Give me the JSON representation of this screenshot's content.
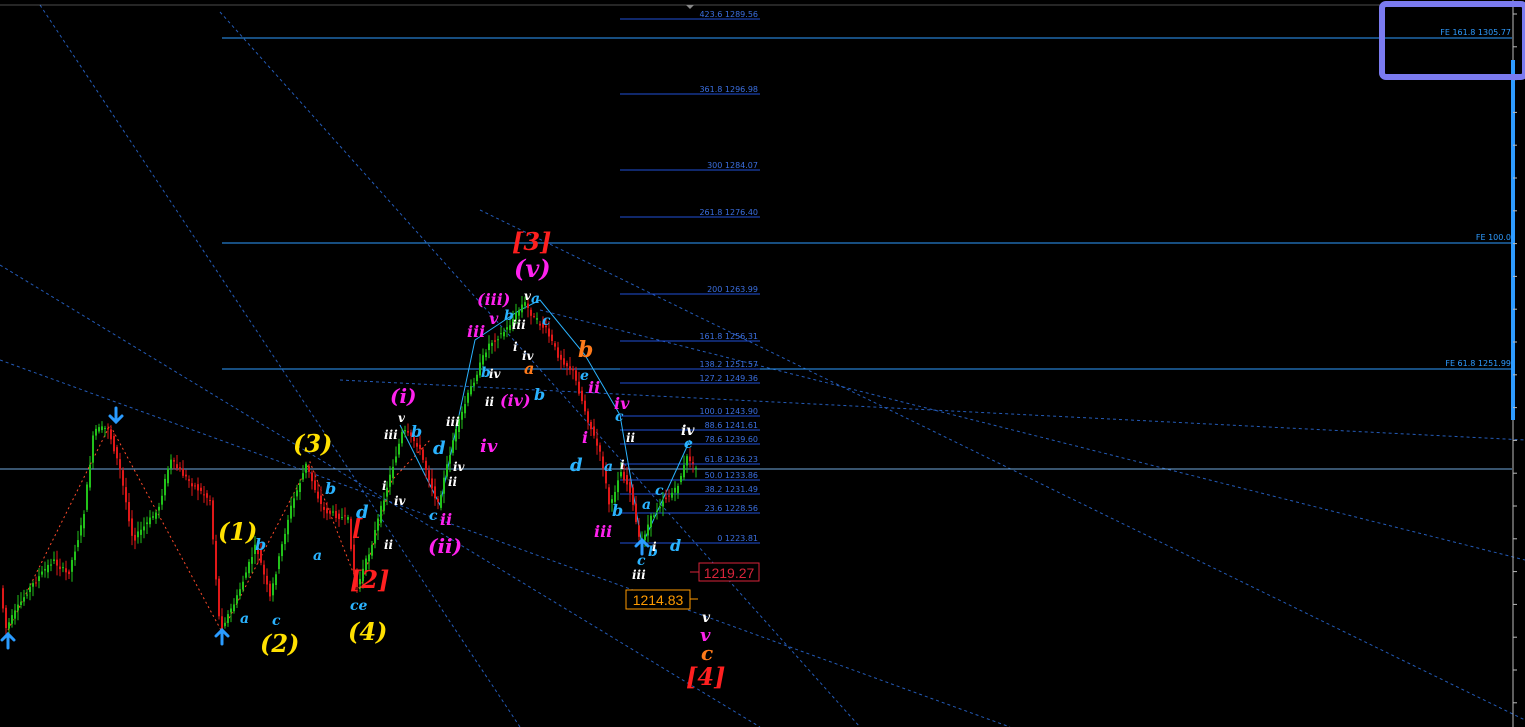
{
  "chart_data": {
    "type": "candlestick",
    "colors": {
      "background": "#000000",
      "bull_candle": "#22c21a",
      "bear_candle": "#e01818",
      "fib_level": "#1f4fd6",
      "fe_level": "#2e9bff",
      "trendline": "#2b6bd8",
      "price_line": "#6fa8dc",
      "highlight_box": "#7b7bf0",
      "price_box_orange": "#ff9a00",
      "price_box_red": "#d8243a"
    },
    "fib_levels": [
      {
        "label": "423.6  1289.56"
      },
      {
        "label": "361.8  1296.98"
      },
      {
        "label": "300  1284.07"
      },
      {
        "label": "261.8  1276.40"
      },
      {
        "label": "200  1263.99"
      },
      {
        "label": "161.8  1256.31"
      },
      {
        "label": "138.2  1251.57"
      },
      {
        "label": "127.2  1249.36"
      },
      {
        "label": "100.0  1243.90"
      },
      {
        "label": "88.6  1241.61"
      },
      {
        "label": "78.6  1239.60"
      },
      {
        "label": "61.8  1236.23"
      },
      {
        "label": "50.0  1233.86"
      },
      {
        "label": "38.2  1231.49"
      },
      {
        "label": "23.6  1228.56"
      },
      {
        "label": "0  1223.81"
      }
    ],
    "fe_levels": [
      {
        "label": "FE 161.8  1305.77"
      },
      {
        "label": "FE 100.0"
      },
      {
        "label": "FE 61.8  1251.99"
      }
    ],
    "price_labels": {
      "orange": "1214.83",
      "red": "1219.27"
    },
    "wave_labels": [
      {
        "text": "(1)",
        "color": "#ffe000"
      },
      {
        "text": "(2)",
        "color": "#ffe000"
      },
      {
        "text": "(3)",
        "color": "#ffe000"
      },
      {
        "text": "(4)",
        "color": "#ffe000"
      },
      {
        "text": "[2]",
        "color": "#ff2020"
      },
      {
        "text": "[3]",
        "color": "#ff2020"
      },
      {
        "text": "[4]",
        "color": "#ff2020"
      },
      {
        "text": "[",
        "color": "#ff2020"
      },
      {
        "text": "(i)",
        "color": "#ff22ee"
      },
      {
        "text": "(ii)",
        "color": "#ff22ee"
      },
      {
        "text": "(iii)",
        "color": "#ff22ee"
      },
      {
        "text": "(iv)",
        "color": "#ff22ee"
      },
      {
        "text": "(v)",
        "color": "#ff22ee"
      },
      {
        "text": "a",
        "color": "#2ab3ff"
      },
      {
        "text": "b",
        "color": "#2ab3ff"
      },
      {
        "text": "c",
        "color": "#2ab3ff"
      },
      {
        "text": "d",
        "color": "#2ab3ff"
      },
      {
        "text": "e",
        "color": "#2ab3ff"
      },
      {
        "text": "ce",
        "color": "#2ab3ff"
      },
      {
        "text": "i",
        "color": "#ffffff"
      },
      {
        "text": "ii",
        "color": "#ffffff"
      },
      {
        "text": "iii",
        "color": "#ffffff"
      },
      {
        "text": "iv",
        "color": "#ffffff"
      },
      {
        "text": "v",
        "color": "#ffffff"
      },
      {
        "text": "i",
        "color": "#ff22ee"
      },
      {
        "text": "ii",
        "color": "#ff22ee"
      },
      {
        "text": "iii",
        "color": "#ff22ee"
      },
      {
        "text": "iv",
        "color": "#ff22ee"
      },
      {
        "text": "v",
        "color": "#ff22ee"
      },
      {
        "text": "b",
        "color": "#ff7a1a"
      },
      {
        "text": "a",
        "color": "#ff7a1a"
      },
      {
        "text": "c",
        "color": "#ff7a1a"
      }
    ]
  }
}
